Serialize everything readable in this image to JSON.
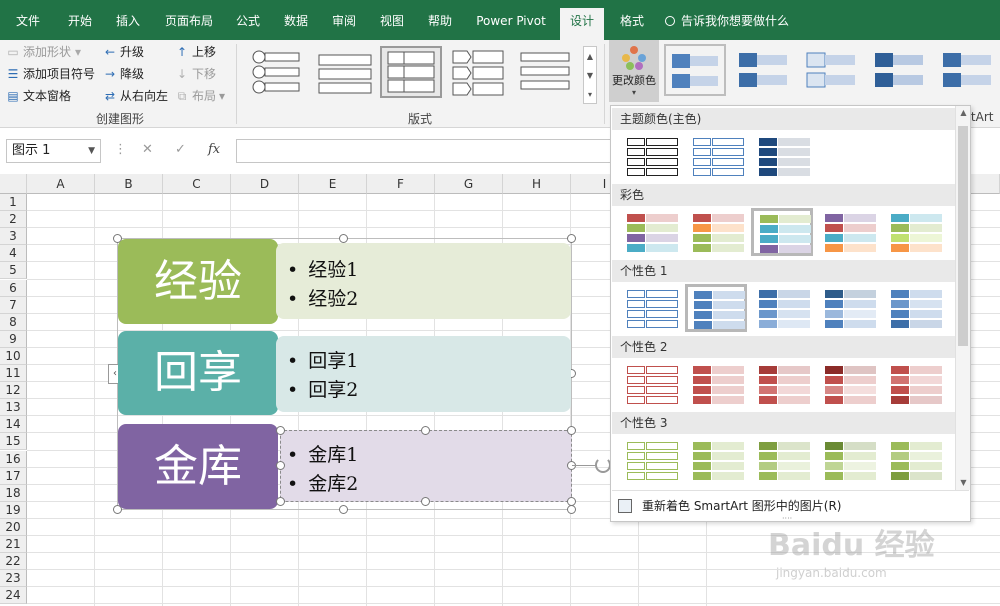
{
  "tabs": [
    {
      "label": "文件"
    },
    {
      "label": "开始"
    },
    {
      "label": "插入"
    },
    {
      "label": "页面布局"
    },
    {
      "label": "公式"
    },
    {
      "label": "数据"
    },
    {
      "label": "审阅"
    },
    {
      "label": "视图"
    },
    {
      "label": "帮助"
    },
    {
      "label": "Power Pivot"
    },
    {
      "label": "设计"
    },
    {
      "label": "格式"
    }
  ],
  "tell_me": "告诉我你想要做什么",
  "create_group": {
    "label": "创建图形",
    "add_shape": "添加形状",
    "add_bullet": "添加项目符号",
    "text_pane": "文本窗格",
    "promote": "升级",
    "demote": "降级",
    "rtl": "从右向左",
    "move_up": "上移",
    "move_down": "下移",
    "layout": "布局"
  },
  "layouts_group": {
    "label": "版式"
  },
  "change_colors": "更改颜色",
  "name_box": "图示 1",
  "fx": "fx",
  "columns": [
    "A",
    "B",
    "C",
    "D",
    "E",
    "F",
    "G",
    "H",
    "I"
  ],
  "rows": [
    "1",
    "2",
    "3",
    "4",
    "5",
    "6",
    "7",
    "8",
    "9",
    "10",
    "11",
    "12",
    "13",
    "14",
    "15",
    "16",
    "17",
    "18",
    "19",
    "20",
    "21",
    "22",
    "23",
    "24"
  ],
  "smartart": {
    "items": [
      {
        "title": "经验",
        "bullets": [
          "经验1",
          "经验2"
        ],
        "color": "#9bbb59",
        "light": "#e6ecd8"
      },
      {
        "title": "回享",
        "bullets": [
          "回享1",
          "回享2"
        ],
        "color": "#4bacc6",
        "light": "#d8e8e7"
      },
      {
        "title": "金库",
        "bullets": [
          "金库1",
          "金库2"
        ],
        "color": "#8064a2",
        "light": "#e2dbe8"
      }
    ]
  },
  "dropdown": {
    "sections": [
      {
        "label": "主题颜色(主色)"
      },
      {
        "label": "彩色"
      },
      {
        "label": "个性色 1"
      },
      {
        "label": "个性色 2"
      },
      {
        "label": "个性色 3"
      }
    ],
    "footer": "重新着色 SmartArt 图形中的图片(R)"
  },
  "partial_text": "rtArt",
  "watermark": {
    "main": "Baidu 经验",
    "sub": "jingyan.baidu.com"
  },
  "colors": {
    "excel_green": "#217346",
    "accent1": "#4f81bd",
    "accent2": "#c0504d",
    "accent3": "#9bbb59"
  }
}
